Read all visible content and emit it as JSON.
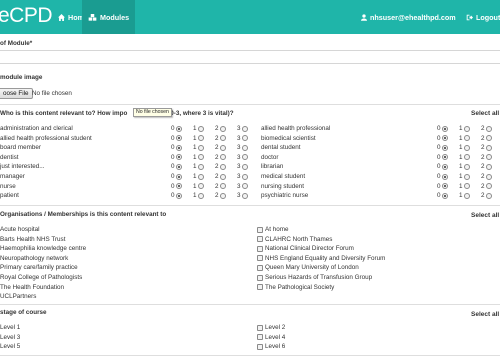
{
  "brand": "eCPD",
  "nav": {
    "home": "Home",
    "modules": "Modules",
    "user": "nhsuser@ehealthpd.com",
    "logout": "Logout"
  },
  "form": {
    "name_label": "of Module*",
    "image_label": "module image",
    "choose_file": "oose File",
    "no_file": "No file chosen",
    "tooltip": "No file chosen",
    "relevance_label": "Who is this content relevant to? How impo",
    "relevance_label_tail": "them (0-3, where 3 is vital)?",
    "select_all": "Select all",
    "scale": [
      "0",
      "1",
      "2",
      "3"
    ],
    "roles_left": [
      "administration and clerical",
      "allied health professional student",
      "board member",
      "dentist",
      "just interested...",
      "manager",
      "nurse",
      "patient"
    ],
    "roles_right": [
      "allied health professional",
      "biomedical scientist",
      "dental student",
      "doctor",
      "librarian",
      "medical student",
      "nursing student",
      "psychiatric nurse"
    ],
    "orgs_label": "Organisations / Memberships is this content relevant to",
    "orgs_left": [
      "Acute hospital",
      "Barts Health NHS Trust",
      "Haemophilia knowledge centre",
      "Neuropathology network",
      "Primary care/family practice",
      "Royal College of Pathologists",
      "The Health Foundation",
      "UCLPartners"
    ],
    "orgs_right": [
      "At home",
      "CLAHRC North Thames",
      "National Clinical Director Forum",
      "NHS England Equality and Diversity Forum",
      "Queen Mary University of London",
      "Serious Hazards of Transfusion Group",
      "The Pathological Society"
    ],
    "stage_label": "stage of course",
    "stages_left": [
      "Level 1",
      "Level 3",
      "Level 5"
    ],
    "stages_right": [
      "Level 2",
      "Level 4",
      "Level 6"
    ]
  },
  "colors": {
    "navbar": "#1fb5a9",
    "active": "#1a9c91"
  }
}
